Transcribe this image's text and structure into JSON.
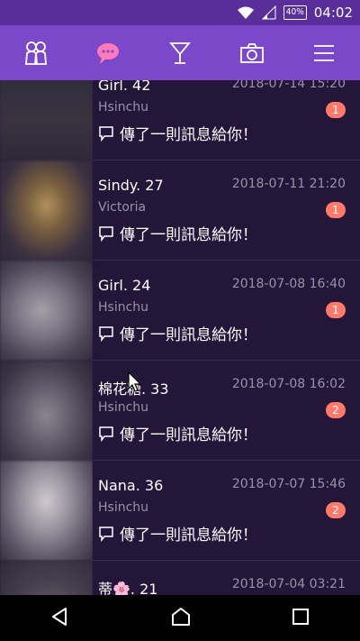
{
  "status_bar": {
    "battery": "40%",
    "time": "04:02",
    "icons": [
      "wifi-icon",
      "signal-icon",
      "battery-icon"
    ]
  },
  "top_nav": {
    "tabs": [
      {
        "icon": "users-icon"
      },
      {
        "icon": "chat-icon",
        "active": true
      },
      {
        "icon": "cocktail-icon"
      },
      {
        "icon": "camera-icon"
      },
      {
        "icon": "menu-icon"
      }
    ]
  },
  "conversations": [
    {
      "name": "Girl. 42",
      "time": "2018-07-14 15:20",
      "city": "Hsinchu",
      "unread": "1",
      "message": "傳了一則訊息給你！"
    },
    {
      "name": "Sindy. 27",
      "time": "2018-07-11 21:20",
      "city": "Victoria",
      "unread": "1",
      "message": "傳了一則訊息給你！"
    },
    {
      "name": "Girl. 24",
      "time": "2018-07-08 16:40",
      "city": "Hsinchu",
      "unread": "1",
      "message": "傳了一則訊息給你！"
    },
    {
      "name": "棉花糖. 33",
      "time": "2018-07-08 16:02",
      "city": "Hsinchu",
      "unread": "2",
      "message": "傳了一則訊息給你！"
    },
    {
      "name": "Nana. 36",
      "time": "2018-07-07 15:46",
      "city": "Hsinchu",
      "unread": "2",
      "message": "傳了一則訊息給你！"
    },
    {
      "name": "蒂🌸. 21",
      "time": "2018-07-04 03:21",
      "city": "",
      "unread": "",
      "message": ""
    }
  ],
  "colors": {
    "status_bar": "#5a2e9a",
    "top_nav": "#7a48c8",
    "active_icon": "#ff7ab8",
    "list_bg": "#241639",
    "badge": "#ff7a6a"
  }
}
